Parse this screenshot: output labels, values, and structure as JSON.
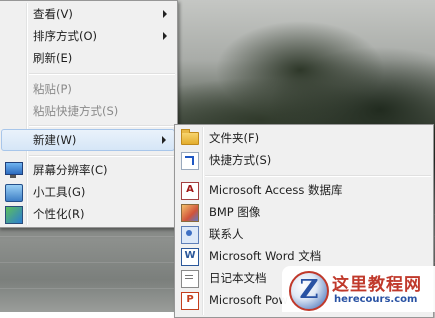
{
  "context_menu": {
    "items": [
      {
        "label": "查看(V)"
      },
      {
        "label": "排序方式(O)"
      },
      {
        "label": "刷新(E)"
      },
      {
        "label": "粘贴(P)"
      },
      {
        "label": "粘贴快捷方式(S)"
      },
      {
        "label": "新建(W)"
      },
      {
        "label": "屏幕分辨率(C)",
        "icon": "screen-resolution-icon"
      },
      {
        "label": "小工具(G)",
        "icon": "gadgets-icon"
      },
      {
        "label": "个性化(R)",
        "icon": "personalize-icon"
      }
    ]
  },
  "new_submenu": {
    "items": [
      {
        "label": "文件夹(F)",
        "icon": "folder-icon"
      },
      {
        "label": "快捷方式(S)",
        "icon": "shortcut-icon"
      },
      {
        "label": "Microsoft Access 数据库",
        "icon": "access-icon"
      },
      {
        "label": "BMP 图像",
        "icon": "bmp-image-icon"
      },
      {
        "label": "联系人",
        "icon": "contact-icon"
      },
      {
        "label": "Microsoft Word 文档",
        "icon": "word-icon"
      },
      {
        "label": "日记本文档",
        "icon": "journal-icon"
      },
      {
        "label": "Microsoft Pow",
        "icon": "powerpoint-icon"
      }
    ]
  },
  "watermark": {
    "title": "这里教程网",
    "url": "herecours.com"
  }
}
